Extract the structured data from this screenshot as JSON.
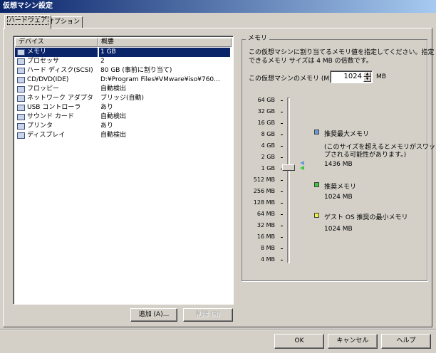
{
  "window": {
    "title": "仮想マシン設定"
  },
  "tabs": [
    {
      "label": "ハードウェア",
      "active": true
    },
    {
      "label": "オプション",
      "active": false
    }
  ],
  "device_list": {
    "columns": [
      "デバイス",
      "概要"
    ],
    "rows": [
      {
        "device": "メモリ",
        "summary": "1 GB",
        "icon": "memory-icon",
        "selected": true
      },
      {
        "device": "プロセッサ",
        "summary": "2",
        "icon": "processor-icon"
      },
      {
        "device": "ハード ディスク(SCSI)",
        "summary": "80 GB (事前に割り当て)",
        "icon": "hard-disk-icon"
      },
      {
        "device": "CD/DVD(IDE)",
        "summary": "D:¥Program Files¥VMware¥iso¥760...",
        "icon": "cd-dvd-icon"
      },
      {
        "device": "フロッピー",
        "summary": "自動検出",
        "icon": "floppy-icon"
      },
      {
        "device": "ネットワーク アダプタ",
        "summary": "ブリッジ(自動)",
        "icon": "network-adapter-icon"
      },
      {
        "device": "USB コントローラ",
        "summary": "あり",
        "icon": "usb-controller-icon"
      },
      {
        "device": "サウンド カード",
        "summary": "自動検出",
        "icon": "sound-card-icon"
      },
      {
        "device": "プリンタ",
        "summary": "あり",
        "icon": "printer-icon"
      },
      {
        "device": "ディスプレイ",
        "summary": "自動検出",
        "icon": "display-icon"
      }
    ]
  },
  "list_buttons": {
    "add": "追加 (A)...",
    "remove": "削除 (R)"
  },
  "memory": {
    "group_title": "メモリ",
    "description_line1": "この仮想マシンに割り当てるメモリ値を指定してください。指定",
    "description_line2": "できるメモリ サイズは 4 MB の倍数です。",
    "input_label": "この仮想マシンのメモリ (M):",
    "value": "1024",
    "unit": "MB",
    "scale_labels": [
      "64 GB",
      "32 GB",
      "16 GB",
      "8 GB",
      "4 GB",
      "2 GB",
      "1 GB",
      "512 MB",
      "256 MB",
      "128 MB",
      "64 MB",
      "32 MB",
      "16 MB",
      "8 MB",
      "4 MB"
    ],
    "slider_value_mb": 1024,
    "legend": {
      "max_title": "推奨最大メモリ",
      "max_note1": "(このサイズを超えるとメモリがスワッ",
      "max_note2": "プされる可能性があります。)",
      "max_value": "1436 MB",
      "max_color": "#6a9ad8",
      "rec_title": "推奨メモリ",
      "rec_value": "1024 MB",
      "rec_color": "#3cc83c",
      "min_title": "ゲスト OS 推奨の最小メモリ",
      "min_value": "1024 MB",
      "min_color": "#f0f040"
    }
  },
  "dialog_buttons": {
    "ok": "OK",
    "cancel": "キャンセル",
    "help": "ヘルプ"
  }
}
